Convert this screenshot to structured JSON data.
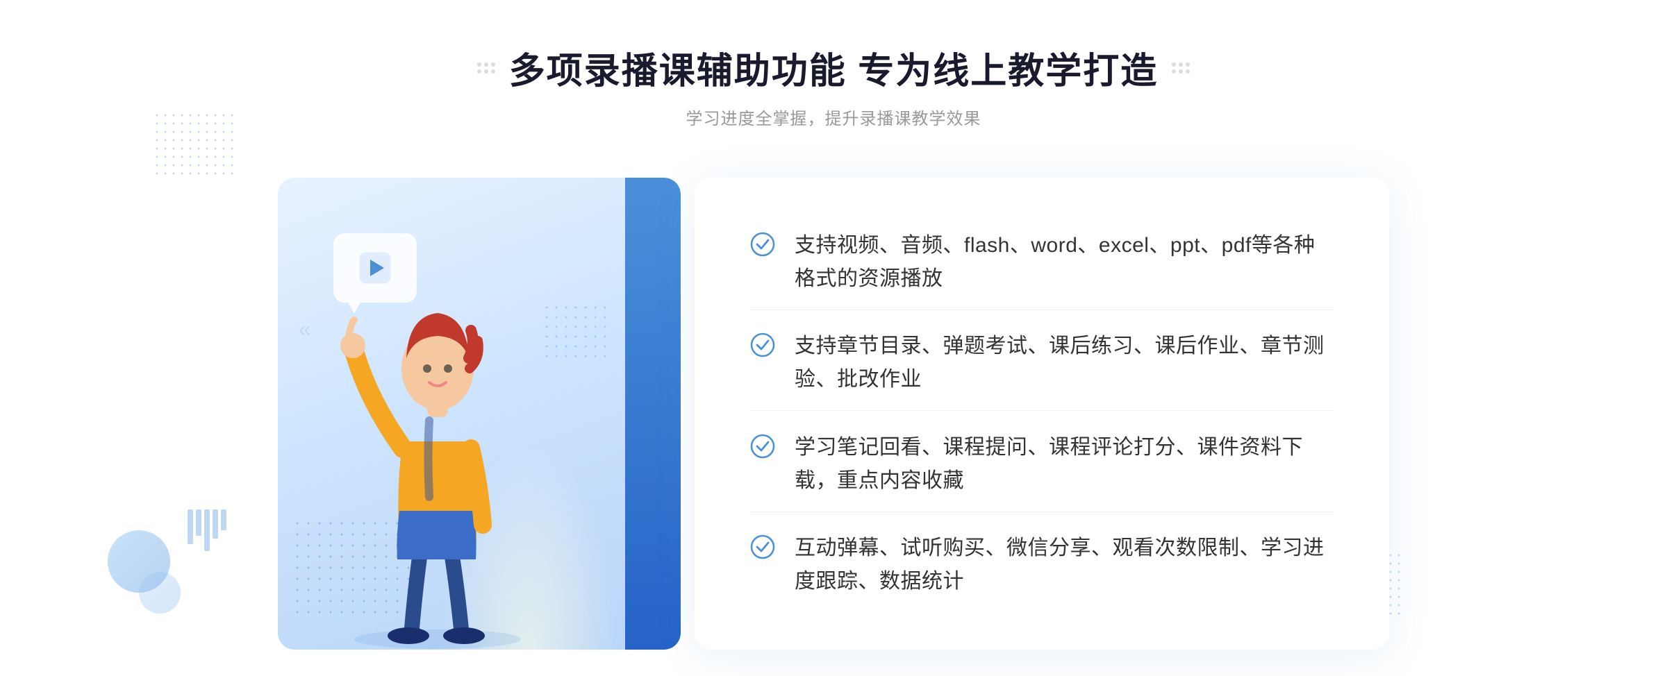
{
  "header": {
    "title": "多项录播课辅助功能 专为线上教学打造",
    "subtitle": "学习进度全掌握，提升录播课教学效果"
  },
  "features": [
    {
      "id": "feature-1",
      "text": "支持视频、音频、flash、word、excel、ppt、pdf等各种格式的资源播放"
    },
    {
      "id": "feature-2",
      "text": "支持章节目录、弹题考试、课后练习、课后作业、章节测验、批改作业"
    },
    {
      "id": "feature-3",
      "text": "学习笔记回看、课程提问、课程评论打分、课件资料下载，重点内容收藏"
    },
    {
      "id": "feature-4",
      "text": "互动弹幕、试听购买、微信分享、观看次数限制、学习进度跟踪、数据统计"
    }
  ],
  "colors": {
    "primary": "#4a90d9",
    "primary_dark": "#2563c8",
    "text_main": "#1a1a2e",
    "text_sub": "#999999",
    "text_feature": "#333333",
    "bg_illus": "#d0e6ff",
    "check_color": "#4a90d9"
  },
  "icons": {
    "check": "check-circle-icon",
    "play": "play-icon",
    "arrow_left": "chevron-double-left-icon",
    "arrow_right": "chevron-double-right-icon"
  }
}
